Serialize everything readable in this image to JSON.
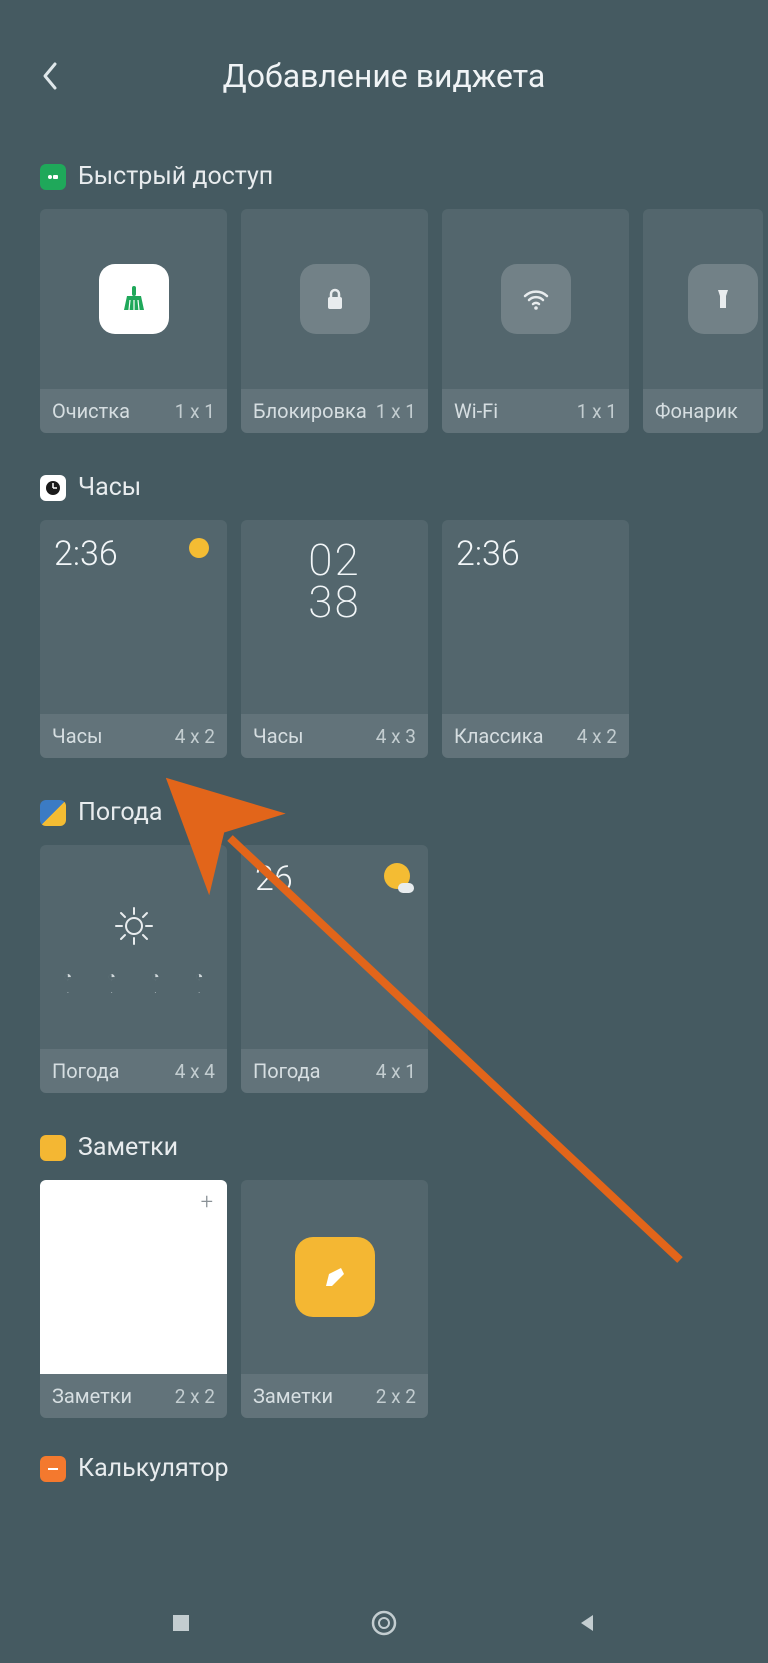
{
  "header": {
    "title": "Добавление виджета"
  },
  "sections": {
    "quick_access": {
      "title": "Быстрый доступ",
      "icon_bg": "#1fa85a",
      "items": [
        {
          "label": "Очистка",
          "size": "1 x 1",
          "icon": "broom"
        },
        {
          "label": "Блокировка",
          "size": "1 x 1",
          "icon": "lock"
        },
        {
          "label": "Wi-Fi",
          "size": "1 x 1",
          "icon": "wifi"
        },
        {
          "label": "Фонарик",
          "size": "1 x 1",
          "icon": "flashlight"
        }
      ]
    },
    "clock": {
      "title": "Часы",
      "items": [
        {
          "label": "Часы",
          "size": "4 x 2",
          "time": "2:36"
        },
        {
          "label": "Часы",
          "size": "4 x 3",
          "time_top": "02",
          "time_bottom": "38"
        },
        {
          "label": "Классика",
          "size": "4 x 2",
          "time": "2:36"
        }
      ]
    },
    "weather": {
      "title": "Погода",
      "items": [
        {
          "label": "Погода",
          "size": "4 x 4"
        },
        {
          "label": "Погода",
          "size": "4 x 1",
          "temp": "26"
        }
      ]
    },
    "notes": {
      "title": "Заметки",
      "icon_bg": "#f4b733",
      "items": [
        {
          "label": "Заметки",
          "size": "2 x 2"
        },
        {
          "label": "Заметки",
          "size": "2 x 2"
        }
      ]
    },
    "calculator": {
      "title": "Калькулятор",
      "icon_bg": "#f4792e"
    }
  }
}
